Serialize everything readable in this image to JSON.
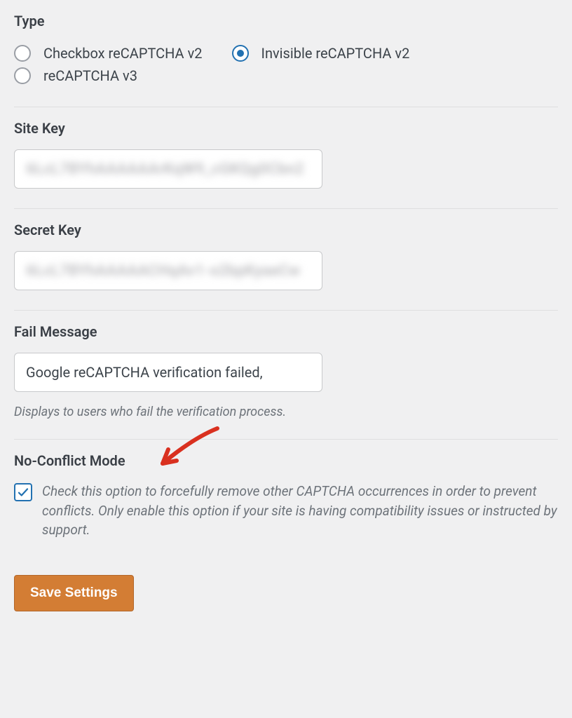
{
  "type": {
    "heading": "Type",
    "options": [
      {
        "label": "Checkbox reCAPTCHA v2",
        "selected": false
      },
      {
        "label": "Invisible reCAPTCHA v2",
        "selected": true
      },
      {
        "label": "reCAPTCHA v3",
        "selected": false
      }
    ]
  },
  "site_key": {
    "heading": "Site Key",
    "value": "6LcL7BYhAAAAAArKqW9_cGKQg0Cbn2"
  },
  "secret_key": {
    "heading": "Secret Key",
    "value": "6LcL7BYhAAAAACHqAv1-o2bpKyaeCw"
  },
  "fail_message": {
    "heading": "Fail Message",
    "value": "Google reCAPTCHA verification failed,",
    "helper": "Displays to users who fail the verification process."
  },
  "no_conflict": {
    "heading": "No-Conflict Mode",
    "checked": true,
    "description": "Check this option to forcefully remove other CAPTCHA occurrences in order to prevent conflicts. Only enable this option if your site is having compatibility issues or instructed by support."
  },
  "actions": {
    "save_label": "Save Settings"
  }
}
